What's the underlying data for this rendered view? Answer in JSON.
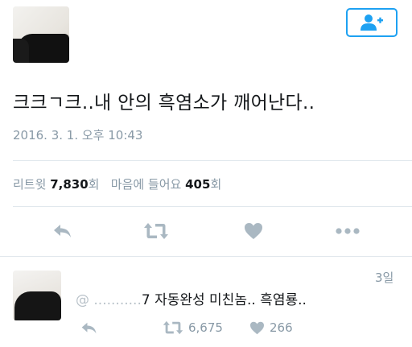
{
  "tweet": {
    "text": "크크ㄱ크..내 안의 흑염소가 깨어난다..",
    "timestamp": "2016. 3. 1. 오후 10:43",
    "retweets_label": "리트윗",
    "retweets_count": "7,830",
    "count_suffix": "회",
    "likes_label": "마음에 들어요",
    "likes_count": "405"
  },
  "follow_button": {
    "icon": "add-user-icon",
    "color": "#1da1f2"
  },
  "reply": {
    "time": "3일",
    "text_faded": "@ ...........",
    "text": "7 자동완성 미친놈.. 흑염룡..",
    "retweets_count": "6,675",
    "likes_count": "266"
  },
  "colors": {
    "accent": "#1da1f2",
    "muted": "#8899a6",
    "icon": "#aab8c2"
  }
}
